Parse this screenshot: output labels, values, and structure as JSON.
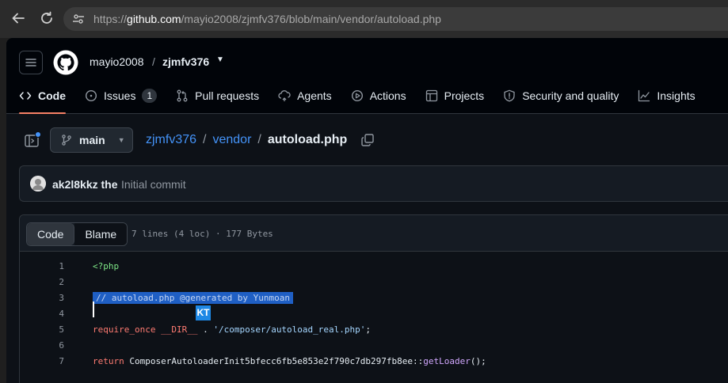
{
  "browser": {
    "url_scheme": "https://",
    "url_host": "github.com",
    "url_path": "/mayio2008/zjmfv376/blob/main/vendor/autoload.php"
  },
  "header": {
    "owner": "mayio2008",
    "separator": "/",
    "repo": "zjmfv376"
  },
  "tabs": [
    {
      "label": "Code",
      "icon": "code-icon",
      "active": true
    },
    {
      "label": "Issues",
      "icon": "issue-icon",
      "count": "1"
    },
    {
      "label": "Pull requests",
      "icon": "pull-request-icon"
    },
    {
      "label": "Agents",
      "icon": "agents-icon"
    },
    {
      "label": "Actions",
      "icon": "play-icon"
    },
    {
      "label": "Projects",
      "icon": "table-icon"
    },
    {
      "label": "Security and quality",
      "icon": "shield-icon"
    },
    {
      "label": "Insights",
      "icon": "graph-icon"
    }
  ],
  "breadcrumb": {
    "branch": "main",
    "repo": "zjmfv376",
    "folder": "vendor",
    "file": "autoload.php",
    "sep": "/"
  },
  "commit": {
    "author": "ak2l8kkz the",
    "message": "Initial commit"
  },
  "code_view": {
    "tab_code": "Code",
    "tab_blame": "Blame",
    "meta": "7 lines (4 loc) · 177 Bytes",
    "ime_indicator": "KT",
    "lines": [
      {
        "n": "1",
        "parts": [
          {
            "t": "<?php",
            "c": "c-tag"
          }
        ]
      },
      {
        "n": "2",
        "parts": []
      },
      {
        "n": "3",
        "parts": [
          {
            "t": "// autoload.php @generated by Yunmoan",
            "c": "c-com sel"
          }
        ]
      },
      {
        "n": "4",
        "parts": []
      },
      {
        "n": "5",
        "parts": [
          {
            "t": "require_once",
            "c": "c-kw"
          },
          {
            "t": " ",
            "c": ""
          },
          {
            "t": "__DIR__",
            "c": "c-kw"
          },
          {
            "t": " . ",
            "c": ""
          },
          {
            "t": "'/composer/autoload_real.php'",
            "c": "c-str"
          },
          {
            "t": ";",
            "c": ""
          }
        ]
      },
      {
        "n": "6",
        "parts": []
      },
      {
        "n": "7",
        "parts": [
          {
            "t": "return",
            "c": "c-kw"
          },
          {
            "t": " ComposerAutoloaderInit5bfecc6fb5e853e2f790c7db297fb8ee::",
            "c": ""
          },
          {
            "t": "getLoader",
            "c": "c-fn"
          },
          {
            "t": "();",
            "c": ""
          }
        ]
      }
    ]
  },
  "colors": {
    "accent_tab_underline": "#f78166",
    "link": "#4493f8",
    "selection": "#1f5fc4"
  }
}
